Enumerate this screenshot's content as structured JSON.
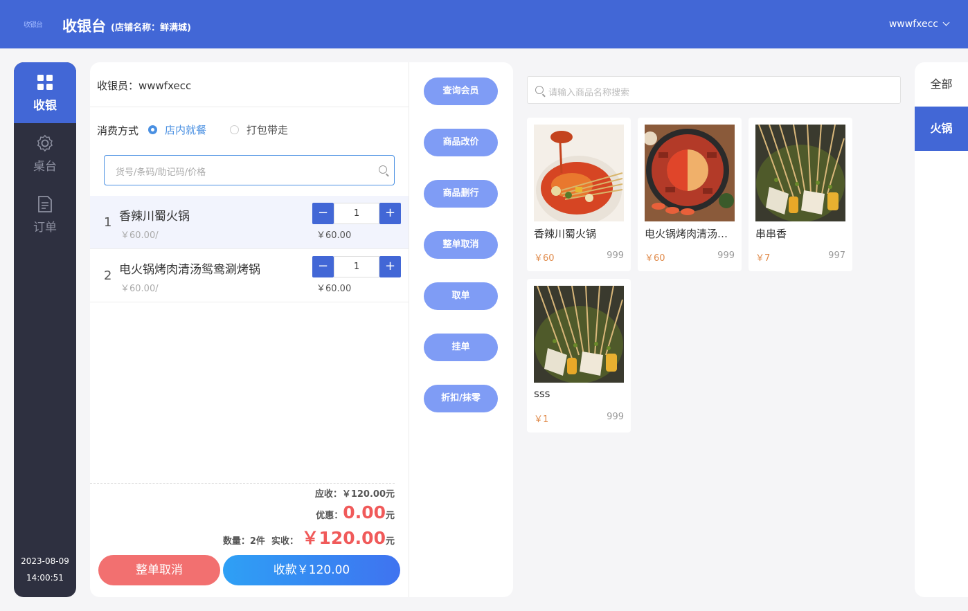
{
  "header": {
    "logo_text": "收银台",
    "title": "收银台",
    "store": "(店铺名称：鲜满城)",
    "username": "wwwfxecc"
  },
  "sidebar": {
    "items": [
      {
        "label": "收银",
        "icon": "grid-icon",
        "active": true
      },
      {
        "label": "桌台",
        "icon": "gear-icon",
        "active": false
      },
      {
        "label": "订单",
        "icon": "document-icon",
        "active": false
      }
    ],
    "date": "2023-08-09",
    "time": "14:00:51"
  },
  "order": {
    "cashier": "收银员：wwwfxecc",
    "mode_label": "消费方式",
    "modes": [
      {
        "label": "店内就餐",
        "selected": true
      },
      {
        "label": "打包带走",
        "selected": false
      }
    ],
    "search_placeholder": "货号/条码/助记码/价格",
    "items": [
      {
        "index": "1",
        "name": "香辣川蜀火锅",
        "price": "￥60.00/",
        "qty": "1",
        "subtotal": "￥60.00",
        "minus": "−",
        "plus": "+"
      },
      {
        "index": "2",
        "name": "电火锅烤肉清汤鸳鸯涮烤锅",
        "price": "￥60.00/",
        "qty": "1",
        "subtotal": "￥60.00",
        "minus": "−",
        "plus": "+"
      }
    ],
    "receivable_label": "应收：",
    "receivable": "￥120.00元",
    "discount_label": "优惠：",
    "discount": "0.00",
    "discount_unit": "元",
    "count_label": "数量：2件",
    "actual_label": "实收：",
    "actual": "￥120.00",
    "actual_unit": "元",
    "cancel_button": "整单取消",
    "pay_button": "收款￥120.00"
  },
  "functions": [
    "查询会员",
    "商品改价",
    "商品删行",
    "整单取消",
    "取单",
    "挂单",
    "折扣/抹零"
  ],
  "products": {
    "search_placeholder": "请输入商品名称搜索",
    "items": [
      {
        "name": "香辣川蜀火锅",
        "price": "￥60",
        "stock": "999"
      },
      {
        "name": "电火锅烤肉清汤鸳鸯涮烤锅",
        "price": "￥60",
        "stock": "999"
      },
      {
        "name": "串串香",
        "price": "￥7",
        "stock": "997"
      },
      {
        "name": "sss",
        "price": "￥1",
        "stock": "999"
      }
    ]
  },
  "categories": [
    {
      "label": "全部",
      "active": false
    },
    {
      "label": "火锅",
      "active": true
    }
  ],
  "colors": {
    "primary": "#4267d6",
    "sidebar": "#2e3040",
    "danger": "#f27070",
    "price": "#e08a4a",
    "function_button": "#7f9cf5"
  }
}
